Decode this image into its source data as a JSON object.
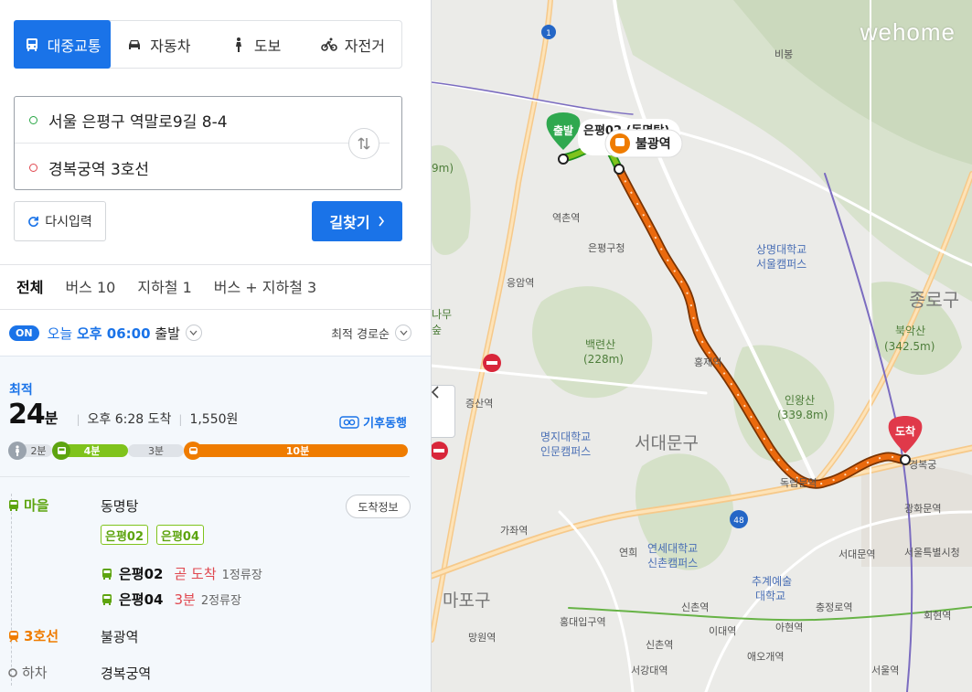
{
  "modes": [
    {
      "label": "대중교통",
      "icon": "bus-icon",
      "active": true
    },
    {
      "label": "자동차",
      "icon": "car-icon"
    },
    {
      "label": "도보",
      "icon": "walk-icon"
    },
    {
      "label": "자전거",
      "icon": "bicycle-icon"
    }
  ],
  "route": {
    "origin": "서울 은평구 역말로9길 8-4",
    "destination": "경복궁역 3호선"
  },
  "buttons": {
    "reset": "다시입력",
    "search": "길찾기"
  },
  "tabs": [
    "전체",
    "버스 10",
    "지하철 1",
    "버스 + 지하철 3"
  ],
  "depart": {
    "badge": "ON",
    "day": "오늘",
    "time": "오후 06:00",
    "suffix": "출발",
    "sort": "최적 경로순"
  },
  "result": {
    "label": "최적",
    "minutes": "24",
    "unit": "분",
    "arrival": "오후 6:28 도착",
    "fare": "1,550원",
    "eco": "기후동행",
    "bar": [
      {
        "type": "walk",
        "label": "2분",
        "share": 0.11
      },
      {
        "type": "bus",
        "label": "4분",
        "share": 0.19
      },
      {
        "type": "walk",
        "label": "3분",
        "share": 0.14
      },
      {
        "type": "sub",
        "label": "10분",
        "share": 0.56
      }
    ],
    "steps": {
      "bus_label": "마을",
      "bus_stop": "동명탕",
      "arrive_info": "도착정보",
      "chips": [
        "은평02",
        "은평04"
      ],
      "bus_lines": [
        {
          "name": "은평02",
          "status": "곧 도착",
          "stops": "1정류장"
        },
        {
          "name": "은평04",
          "status": "3분",
          "stops": "2정류장"
        }
      ],
      "subway_label": "3호선",
      "subway_stop": "불광역",
      "exit_label": "하차",
      "exit_stop": "경복궁역"
    }
  },
  "map": {
    "logo": "wehome",
    "start_badge": "출발",
    "start_name": "은평02 (동명탕)",
    "transfer": "불광역",
    "end_badge": "도착",
    "route_color": "#e8701a",
    "labels": {
      "l_1": "1",
      "l_48": "48",
      "bibong": "비봉",
      "yeokchon": "역촌역",
      "eungam": "응암역",
      "eunpyeong_gu": "은평구청",
      "sangmyung": "상명대학교",
      "sangmyung2": "서울캠퍼스",
      "jongno": "종로구",
      "bugaksan": "북악산",
      "bugaksan_h": "(342.5m)",
      "baekryeon": "백련산",
      "baekryeon_h": "(228m)",
      "hongje": "홍제역",
      "inwang": "인왕산",
      "inwang_h": "(339.8m)",
      "jeungsan": "증산역",
      "myongji": "명지대학교",
      "myongji2": "인문캠퍼스",
      "seodaemun": "서대문구",
      "dongnimmun": "독립문역",
      "gyeongbok": "경복궁",
      "gwanghwamun": "광화문역",
      "gajwa": "가좌역",
      "yeonhui": "연희",
      "yonsei": "연세대학교",
      "yonsei2": "신촌캠퍼스",
      "seodaemun_st": "서대문역",
      "seoul_city": "서울특별시청",
      "chugye": "추계예술",
      "chugye2": "대학교",
      "mapo": "마포구",
      "sinchon": "신촌역",
      "chungjeongno": "충정로역",
      "hongdae": "홍대입구역",
      "ehwa": "이대역",
      "ahyeon": "아현역",
      "hoehyeon": "회현역",
      "mangwon": "망원역",
      "sinchon2": "신촌역",
      "aeogae": "애오개역",
      "seogang": "서강대역",
      "seoul_st": "서울역",
      "left_9m": "9m)",
      "left_namu": "나무",
      "left_sup": "숲"
    }
  }
}
